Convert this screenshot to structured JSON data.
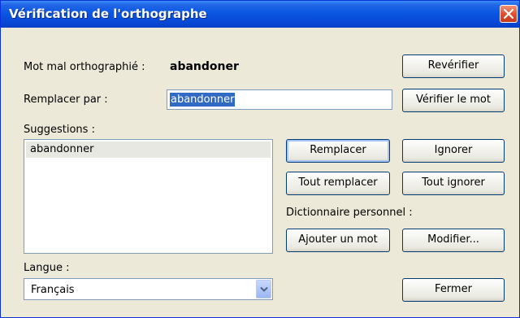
{
  "window": {
    "title": "Vérification de l'orthographe"
  },
  "labels": {
    "misspelled": "Mot mal orthographié :",
    "replace_with": "Remplacer par :",
    "suggestions": "Suggestions :",
    "language": "Langue :",
    "personal_dictionary": "Dictionnaire personnel :"
  },
  "misspelled_word": "abandoner",
  "replace_input": {
    "value": "abandonner"
  },
  "suggestions_list": [
    "abandonner"
  ],
  "language_select": {
    "value": "Français"
  },
  "buttons": {
    "recheck": "Revérifier",
    "check_word": "Vérifier le mot",
    "replace": "Remplacer",
    "ignore": "Ignorer",
    "replace_all": "Tout remplacer",
    "ignore_all": "Tout ignorer",
    "add_word": "Ajouter un mot",
    "modify": "Modifier...",
    "close": "Fermer"
  },
  "colors": {
    "titlebar": "#0a57e2",
    "selection": "#316ac5",
    "window_bg": "#ece9d8"
  },
  "icons": {
    "close": "close-icon",
    "dropdown": "chevron-down-icon"
  }
}
